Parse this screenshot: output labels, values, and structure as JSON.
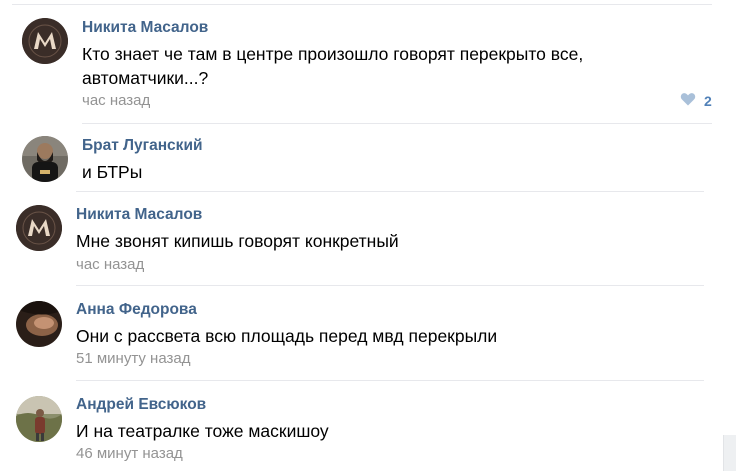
{
  "comments": [
    {
      "author": "Никита Масалов",
      "text_lines": [
        "Кто знает че там в центре произошло говорят перекрыто все,",
        "автоматчики...?"
      ],
      "time": "час назад",
      "likes": "2",
      "avatar_icon": "m-logo-avatar"
    },
    {
      "author": "Брат Луганский",
      "text_lines": [
        "и БТРы"
      ],
      "time": "",
      "avatar_icon": "bearded-man-avatar"
    },
    {
      "author": "Никита Масалов",
      "text_lines": [
        "Мне звонят кипишь говорят конкретный"
      ],
      "time": "час назад",
      "avatar_icon": "m-logo-avatar"
    },
    {
      "author": "Анна Федорова",
      "text_lines": [
        "Они с рассвета всю площадь перед мвд перекрыли"
      ],
      "time": "51 минуту назад",
      "avatar_icon": "photo-avatar"
    },
    {
      "author": "Андрей Евсюков",
      "text_lines": [
        "И на театралке тоже маскишоу"
      ],
      "time": "46 минут назад",
      "avatar_icon": "outdoor-photo-avatar"
    }
  ],
  "colors": {
    "author": "#42648b",
    "time": "#939393",
    "like": "#5181b8",
    "divider": "#e7e8ec"
  }
}
